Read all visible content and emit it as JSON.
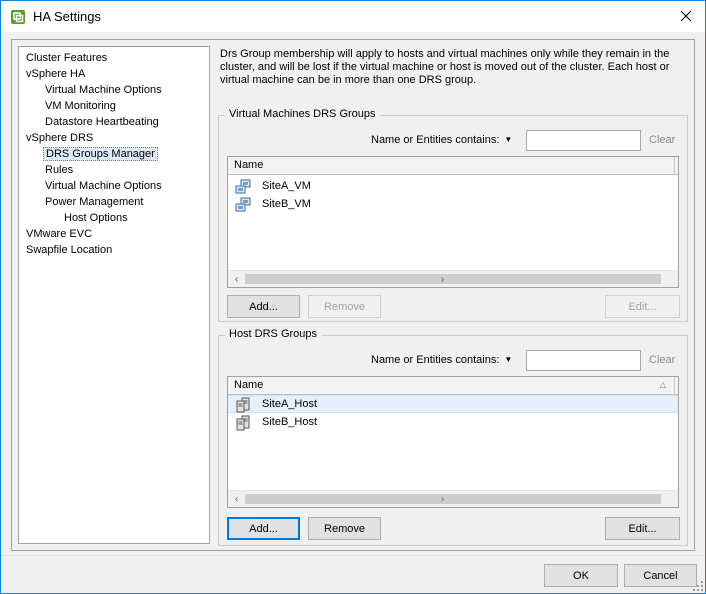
{
  "window": {
    "title": "HA Settings",
    "close_label": "✕"
  },
  "nav": {
    "items": [
      {
        "label": "Cluster Features",
        "level": 0
      },
      {
        "label": "vSphere HA",
        "level": 0
      },
      {
        "label": "Virtual Machine Options",
        "level": 1
      },
      {
        "label": "VM Monitoring",
        "level": 1
      },
      {
        "label": "Datastore Heartbeating",
        "level": 1
      },
      {
        "label": "vSphere DRS",
        "level": 0
      },
      {
        "label": "DRS Groups Manager",
        "level": 1,
        "selected": true
      },
      {
        "label": "Rules",
        "level": 1
      },
      {
        "label": "Virtual Machine Options",
        "level": 1
      },
      {
        "label": "Power Management",
        "level": 1
      },
      {
        "label": "Host Options",
        "level": 2
      },
      {
        "label": "VMware EVC",
        "level": 0
      },
      {
        "label": "Swapfile Location",
        "level": 0
      }
    ]
  },
  "description": "Drs Group membership will apply to hosts and virtual machines only while they remain in the cluster, and will be lost if the virtual machine or host is moved out of the cluster. Each host or virtual machine can be in more than one DRS group.",
  "vm_groups": {
    "legend": "Virtual Machines DRS Groups",
    "filter_label": "Name or Entities contains:",
    "filter_value": "",
    "clear_label": "Clear",
    "column_header": "Name",
    "rows": [
      "SiteA_VM",
      "SiteB_VM"
    ],
    "icon": "vm-group-icon",
    "add_label": "Add...",
    "remove_label": "Remove",
    "edit_label": "Edit..."
  },
  "host_groups": {
    "legend": "Host DRS Groups",
    "filter_label": "Name or Entities contains:",
    "filter_value": "",
    "clear_label": "Clear",
    "column_header": "Name",
    "rows": [
      "SiteA_Host",
      "SiteB_Host"
    ],
    "icon": "host-group-icon",
    "add_label": "Add...",
    "remove_label": "Remove",
    "edit_label": "Edit..."
  },
  "footer": {
    "ok_label": "OK",
    "cancel_label": "Cancel"
  },
  "colors": {
    "accent": "#0078d7",
    "window_border": "#1883d7",
    "selection": "#e5f0fb"
  }
}
